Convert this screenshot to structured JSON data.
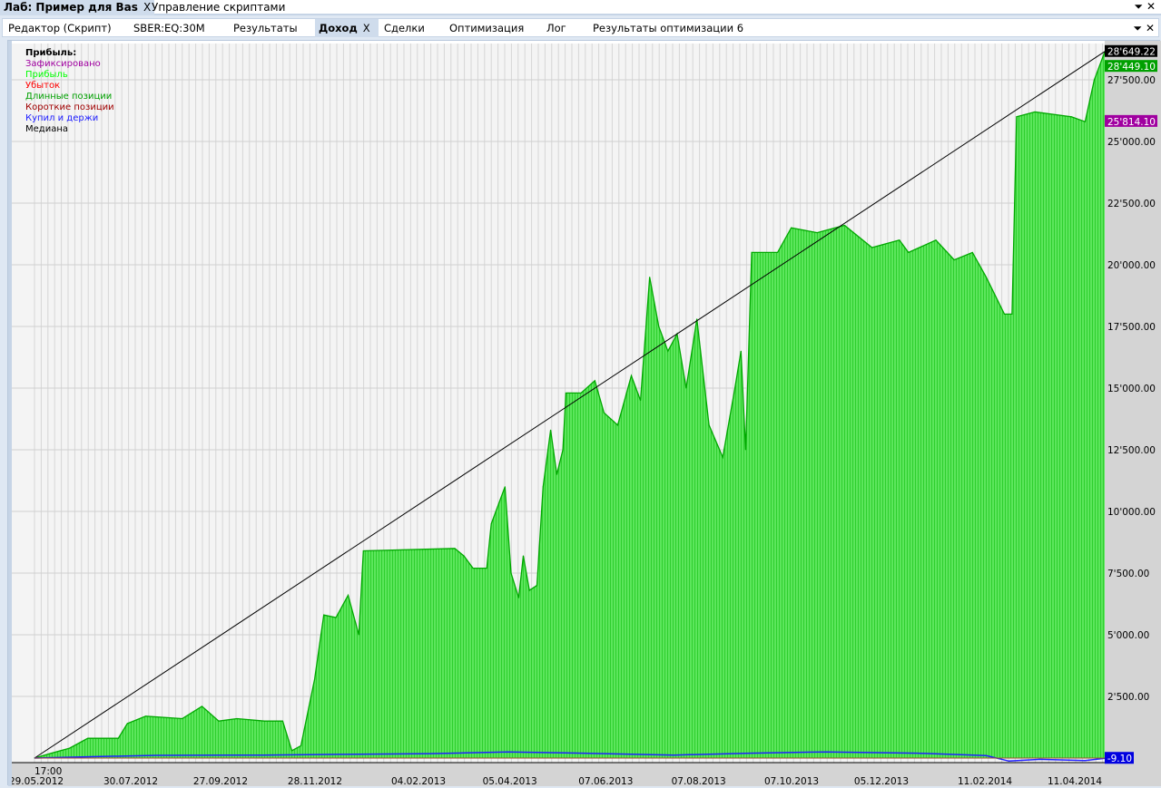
{
  "window": {
    "tabs": [
      {
        "label": "Лаб: Пример для Bas",
        "active": true
      },
      {
        "label": "Управление скриптами",
        "active": false
      }
    ],
    "close": "X"
  },
  "tabs": [
    {
      "label": "Редактор (Скрипт)"
    },
    {
      "label": "SBER:EQ:30M"
    },
    {
      "label": "Результаты"
    },
    {
      "label": "Доход",
      "active": true
    },
    {
      "label": "Сделки"
    },
    {
      "label": "Оптимизация"
    },
    {
      "label": "Лог"
    },
    {
      "label": "Результаты оптимизации 6"
    }
  ],
  "legend": {
    "title": "Прибыль:",
    "items": [
      {
        "label": "Зафиксировано",
        "color": "#a000a0"
      },
      {
        "label": "Прибыль",
        "color": "#00ff00"
      },
      {
        "label": "Убыток",
        "color": "#ff0000"
      },
      {
        "label": "Длинные позиции",
        "color": "#00a000"
      },
      {
        "label": "Короткие позиции",
        "color": "#a00000"
      },
      {
        "label": "Купил и держи",
        "color": "#2020ff"
      },
      {
        "label": "Медиана",
        "color": "#000000"
      }
    ]
  },
  "chart_data": {
    "type": "area",
    "x_unit": "days since 29.05.2012",
    "xlim": [
      0,
      705
    ],
    "ylim": [
      -150,
      29000
    ],
    "time_label": "17:00",
    "x_ticks": [
      {
        "day": 0,
        "label": "29.05.2012"
      },
      {
        "day": 62,
        "label": "30.07.2012"
      },
      {
        "day": 121,
        "label": "27.09.2012"
      },
      {
        "day": 183,
        "label": "28.11.2012"
      },
      {
        "day": 251,
        "label": "04.02.2013"
      },
      {
        "day": 311,
        "label": "05.04.2013"
      },
      {
        "day": 374,
        "label": "07.06.2013"
      },
      {
        "day": 435,
        "label": "07.08.2013"
      },
      {
        "day": 496,
        "label": "07.10.2013"
      },
      {
        "day": 555,
        "label": "05.12.2013"
      },
      {
        "day": 623,
        "label": "11.02.2014"
      },
      {
        "day": 682,
        "label": "11.04.2014"
      }
    ],
    "y_ticks": [
      {
        "value": 2500,
        "label": "2'500.00"
      },
      {
        "value": 5000,
        "label": "5'000.00"
      },
      {
        "value": 7500,
        "label": "7'500.00"
      },
      {
        "value": 10000,
        "label": "10'000.00"
      },
      {
        "value": 12500,
        "label": "12'500.00"
      },
      {
        "value": 15000,
        "label": "15'000.00"
      },
      {
        "value": 17500,
        "label": "17'500.00"
      },
      {
        "value": 20000,
        "label": "20'000.00"
      },
      {
        "value": 22500,
        "label": "22'500.00"
      },
      {
        "value": 25000,
        "label": "25'000.00"
      },
      {
        "value": 27500,
        "label": "27'500.00"
      }
    ],
    "badges": [
      {
        "value": 28649.22,
        "label": "28'649.22",
        "bg": "#000000"
      },
      {
        "value": 28449.1,
        "label": "28'449.10",
        "bg": "#00a000"
      },
      {
        "value": 25814.1,
        "label": "25'814.10",
        "bg": "#a000a0"
      },
      {
        "value": -9.1,
        "label": "-9.10",
        "bg": "#0000e0"
      }
    ],
    "series": [
      {
        "name": "Прибыль",
        "color": "#00e000",
        "points": [
          [
            0,
            0
          ],
          [
            11,
            200
          ],
          [
            23,
            400
          ],
          [
            35,
            800
          ],
          [
            55,
            800
          ],
          [
            61,
            1400
          ],
          [
            73,
            1700
          ],
          [
            97,
            1600
          ],
          [
            110,
            2100
          ],
          [
            121,
            1500
          ],
          [
            133,
            1600
          ],
          [
            151,
            1500
          ],
          [
            163,
            1500
          ],
          [
            169,
            300
          ],
          [
            175,
            500
          ],
          [
            184,
            3200
          ],
          [
            190,
            5800
          ],
          [
            198,
            5700
          ],
          [
            206,
            6600
          ],
          [
            213,
            5000
          ],
          [
            216,
            8400
          ],
          [
            276,
            8500
          ],
          [
            282,
            8200
          ],
          [
            288,
            7700
          ],
          [
            297,
            7700
          ],
          [
            300,
            9500
          ],
          [
            309,
            11000
          ],
          [
            313,
            7500
          ],
          [
            318,
            6500
          ],
          [
            321,
            8200
          ],
          [
            325,
            6800
          ],
          [
            330,
            7000
          ],
          [
            334,
            11000
          ],
          [
            339,
            13300
          ],
          [
            343,
            11500
          ],
          [
            347,
            12500
          ],
          [
            349,
            14800
          ],
          [
            359,
            14800
          ],
          [
            368,
            15300
          ],
          [
            374,
            14000
          ],
          [
            383,
            13500
          ],
          [
            392,
            15500
          ],
          [
            398,
            14500
          ],
          [
            404,
            19500
          ],
          [
            410,
            17500
          ],
          [
            416,
            16500
          ],
          [
            422,
            17200
          ],
          [
            428,
            15000
          ],
          [
            435,
            17800
          ],
          [
            443,
            13500
          ],
          [
            452,
            12200
          ],
          [
            460,
            15000
          ],
          [
            464,
            16500
          ],
          [
            467,
            12500
          ],
          [
            471,
            20500
          ],
          [
            488,
            20500
          ],
          [
            497,
            21500
          ],
          [
            514,
            21300
          ],
          [
            532,
            21600
          ],
          [
            550,
            20700
          ],
          [
            568,
            21000
          ],
          [
            574,
            20500
          ],
          [
            592,
            21000
          ],
          [
            604,
            20200
          ],
          [
            616,
            20500
          ],
          [
            625,
            19500
          ],
          [
            637,
            18000
          ],
          [
            642,
            18000
          ],
          [
            645,
            26000
          ],
          [
            657,
            26200
          ],
          [
            681,
            26000
          ],
          [
            690,
            25800
          ],
          [
            696,
            27500
          ],
          [
            703,
            28649
          ]
        ]
      },
      {
        "name": "Медиана",
        "color": "#000000",
        "points": [
          [
            0,
            0
          ],
          [
            703,
            28649
          ]
        ]
      },
      {
        "name": "Купил и держи",
        "color": "#2020ff",
        "points": [
          [
            0,
            0
          ],
          [
            40,
            60
          ],
          [
            80,
            110
          ],
          [
            150,
            120
          ],
          [
            200,
            150
          ],
          [
            260,
            180
          ],
          [
            311,
            250
          ],
          [
            360,
            200
          ],
          [
            420,
            120
          ],
          [
            470,
            200
          ],
          [
            520,
            250
          ],
          [
            580,
            200
          ],
          [
            625,
            100
          ],
          [
            640,
            -120
          ],
          [
            660,
            -50
          ],
          [
            690,
            -100
          ],
          [
            703,
            -9
          ]
        ]
      }
    ]
  }
}
